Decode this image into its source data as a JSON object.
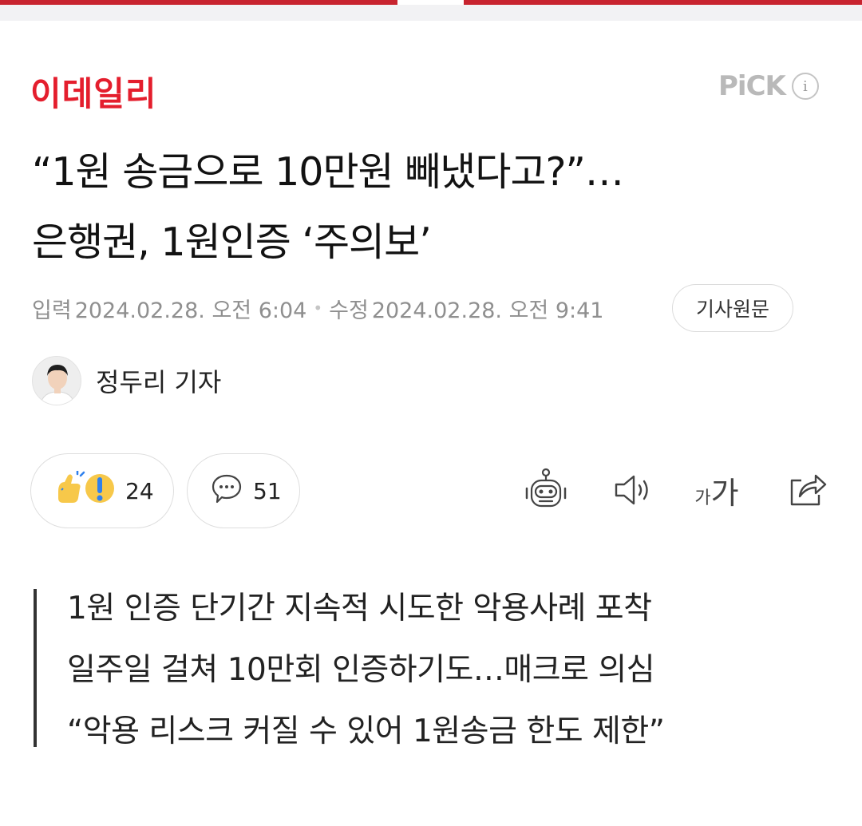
{
  "top_bar": {
    "accent_color": "#c8242f"
  },
  "header": {
    "logo_text": "이데일리",
    "pick_label": "PiCK",
    "info_icon": "i"
  },
  "article": {
    "headline_line1": "“1원 송금으로 10만원 빼냈다고?”…",
    "headline_line2": "은행권, 1원인증 ‘주의보’",
    "meta": {
      "published_label": "입력",
      "published_date": "2024.02.28. 오전 6:04",
      "modified_label": "수정",
      "modified_date": "2024.02.28. 오전 9:41",
      "dot": "•"
    },
    "original_button": "기사원문",
    "reporter": "정두리 기자",
    "summary": [
      "1원 인증 단기간 지속적 시도한 악용사례 포착",
      "일주일 걸쳐 10만회 인증하기도…매크로 의심",
      "“악용 리스크 커질 수 있어 1원송금 한도 제한”"
    ]
  },
  "actions": {
    "reaction_count": "24",
    "comment_count": "51",
    "font_small": "가",
    "font_big": "가"
  },
  "icons": {
    "reaction": "reaction-emoji-icon",
    "comment": "speech-bubble-icon",
    "bot": "robot-summary-icon",
    "speaker": "speaker-icon",
    "font": "font-size-icon",
    "share": "share-icon"
  }
}
